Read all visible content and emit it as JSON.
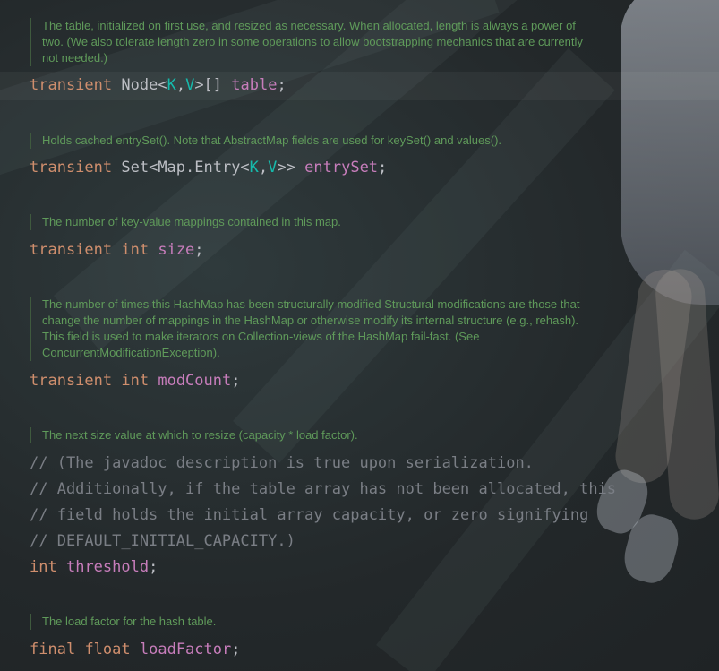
{
  "docs": [
    "The table, initialized on first use, and resized as necessary. When allocated, length is always a power of two. (We also tolerate length zero in some operations to allow bootstrapping mechanics that are currently not needed.)",
    "Holds cached entrySet(). Note that AbstractMap fields are used for keySet() and values().",
    "The number of key-value mappings contained in this map.",
    "The number of times this HashMap has been structurally modified Structural modifications are those that change the number of mappings in the HashMap or otherwise modify its internal structure (e.g., rehash). This field is used to make iterators on Collection-views of the HashMap fail-fast. (See ConcurrentModificationException).",
    "The next size value at which to resize (capacity * load factor).",
    "The load factor for the hash table."
  ],
  "code": {
    "table": {
      "kw": "transient",
      "type_pre": "Node<",
      "k": "K",
      "comma": ",",
      "v": "V",
      "type_post": ">[]",
      "name": "table",
      "semi": ";"
    },
    "entrySet": {
      "kw": "transient",
      "type_pre": "Set<Map.Entry<",
      "k": "K",
      "comma": ",",
      "v": "V",
      "type_post": ">>",
      "name": "entrySet",
      "semi": ";"
    },
    "size": {
      "kw1": "transient",
      "kw2": "int",
      "name": "size",
      "semi": ";"
    },
    "modCount": {
      "kw1": "transient",
      "kw2": "int",
      "name": "modCount",
      "semi": ";"
    },
    "threshold_comments": [
      "// (The javadoc description is true upon serialization.",
      "// Additionally, if the table array has not been allocated, this",
      "// field holds the initial array capacity, or zero signifying",
      "// DEFAULT_INITIAL_CAPACITY.)"
    ],
    "threshold": {
      "kw": "int",
      "name": "threshold",
      "semi": ";"
    },
    "loadFactor": {
      "kw1": "final",
      "kw2": "float",
      "name": "loadFactor",
      "semi": ";"
    }
  }
}
